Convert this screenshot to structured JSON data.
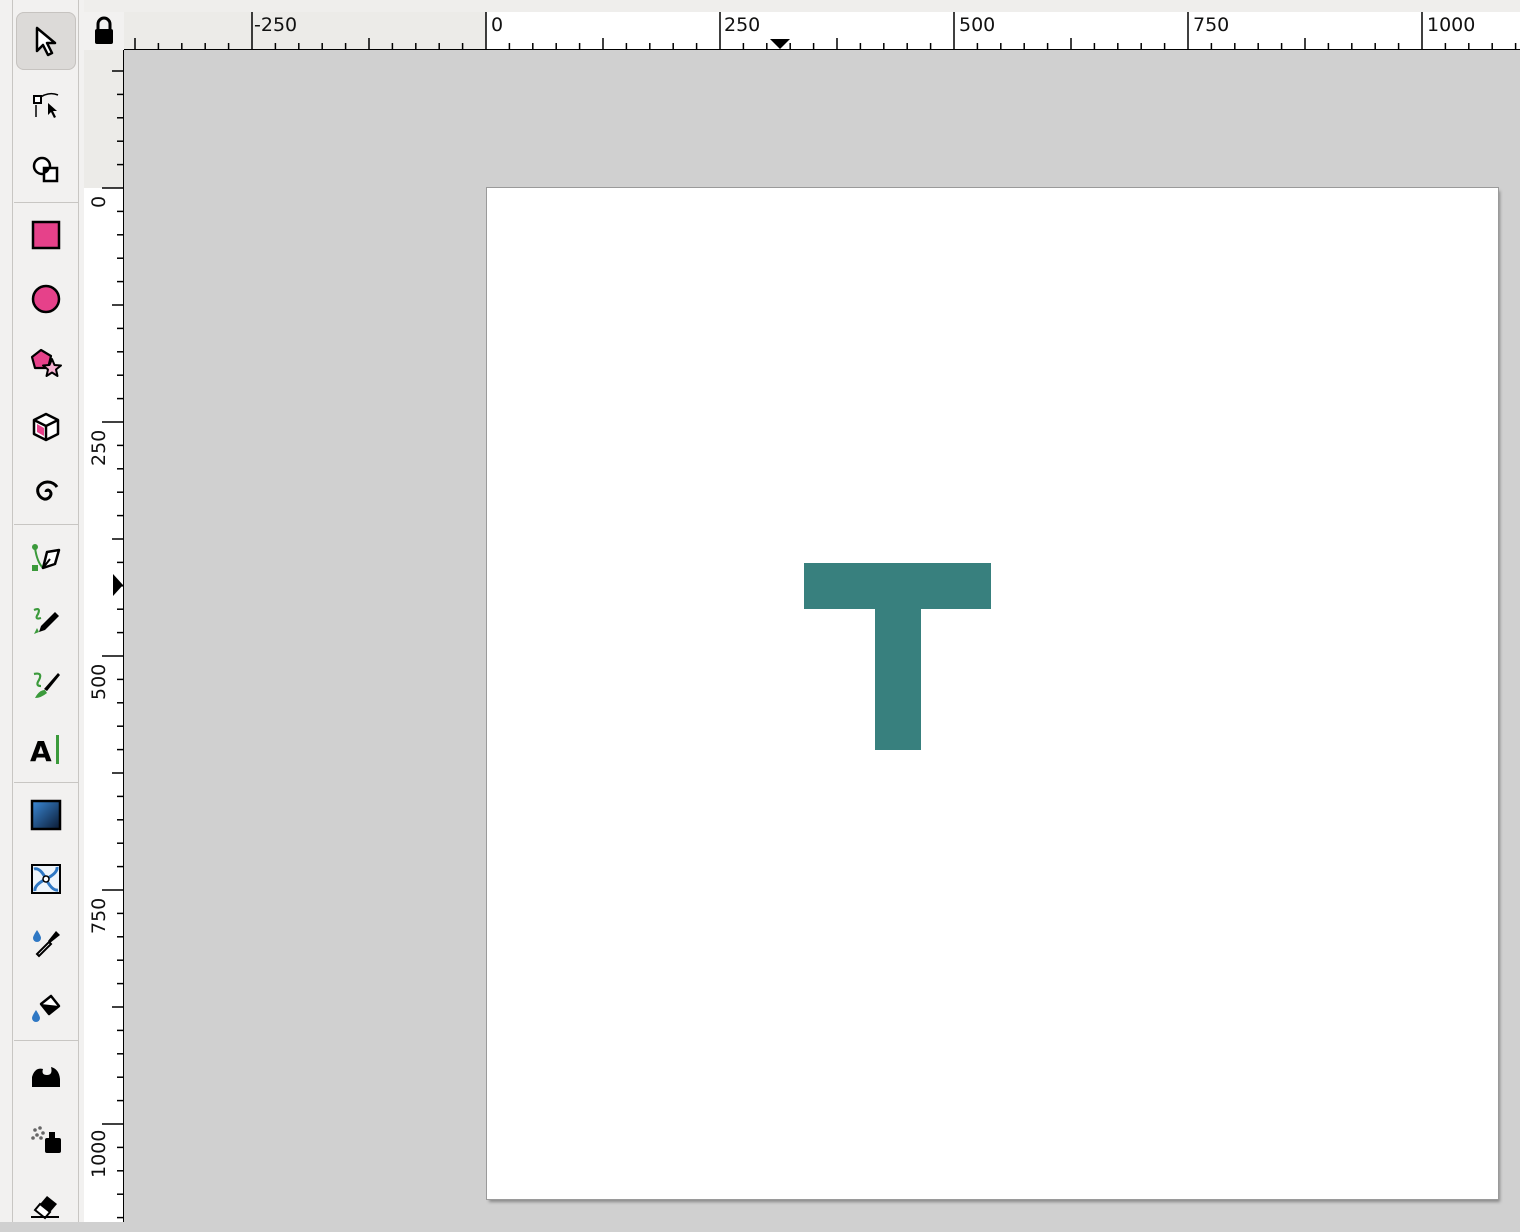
{
  "toolbox": {
    "tools": [
      {
        "name": "selector-tool",
        "icon": "arrow-pointer-icon",
        "active": true
      },
      {
        "name": "node-tool",
        "icon": "node-editor-icon"
      },
      {
        "name": "shape-builder-tool",
        "icon": "shape-builder-icon"
      },
      {
        "name": "rectangle-tool",
        "icon": "rectangle-icon"
      },
      {
        "name": "ellipse-tool",
        "icon": "circle-icon"
      },
      {
        "name": "star-tool",
        "icon": "star-polygon-icon"
      },
      {
        "name": "3d-box-tool",
        "icon": "cube-icon"
      },
      {
        "name": "spiral-tool",
        "icon": "spiral-icon"
      },
      {
        "name": "pen-tool",
        "icon": "bezier-pen-icon"
      },
      {
        "name": "pencil-tool",
        "icon": "pencil-icon"
      },
      {
        "name": "calligraphy-tool",
        "icon": "calligraphy-brush-icon"
      },
      {
        "name": "text-tool",
        "icon": "text-icon",
        "label": "A"
      },
      {
        "name": "gradient-tool",
        "icon": "gradient-icon"
      },
      {
        "name": "mesh-tool",
        "icon": "mesh-icon"
      },
      {
        "name": "dropper-tool",
        "icon": "dropper-icon"
      },
      {
        "name": "paint-bucket-tool",
        "icon": "paint-bucket-icon"
      },
      {
        "name": "tweak-tool",
        "icon": "tweak-icon"
      },
      {
        "name": "spray-tool",
        "icon": "spray-icon"
      },
      {
        "name": "eraser-tool",
        "icon": "eraser-icon"
      }
    ]
  },
  "rulers": {
    "horizontal_labels": [
      "-250",
      "0",
      "250",
      "500",
      "750",
      "1000"
    ],
    "vertical_labels": [
      "0",
      "250",
      "500",
      "750",
      "1000"
    ]
  },
  "canvas": {
    "shape": {
      "type": "T-letter",
      "color": "#38807e"
    }
  },
  "colors": {
    "accent_pink": "#e6418a",
    "accent_green": "#3b9a3b",
    "accent_blue": "#2f78c4",
    "shape_teal": "#38807e"
  }
}
